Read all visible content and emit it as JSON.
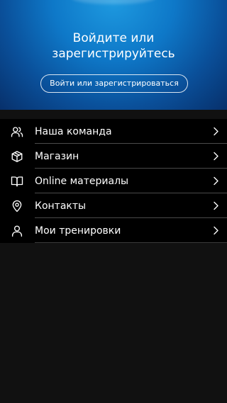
{
  "hero": {
    "title": "Войдите или\nзарегистрируйтесь",
    "login_button_label": "Войти или зарегистрироваться"
  },
  "menu": {
    "items": [
      {
        "label": "Наша команда",
        "icon": "users-icon"
      },
      {
        "label": "Магазин",
        "icon": "box-icon"
      },
      {
        "label": "Online материалы",
        "icon": "book-icon"
      },
      {
        "label": "Контакты",
        "icon": "map-pin-icon"
      },
      {
        "label": "Мои тренировки",
        "icon": "user-icon"
      }
    ]
  },
  "colors": {
    "hero_gradient_center": "#1e9ae0",
    "hero_gradient_edge": "#07306b",
    "menu_background": "#000000",
    "page_background": "#111111",
    "divider": "#4a4a4a",
    "text": "#ffffff"
  }
}
